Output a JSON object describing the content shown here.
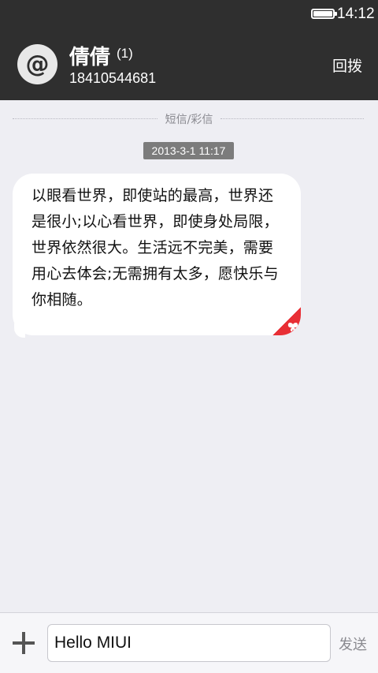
{
  "status_bar": {
    "time": "14:12"
  },
  "header": {
    "avatar_glyph": "@",
    "contact_name": "倩倩",
    "unread_count": "(1)",
    "contact_number": "18410544681",
    "call_back_label": "回拨"
  },
  "conversation": {
    "divider_label": "短信/彩信",
    "timestamp": "2013-3-1 11:17",
    "message": {
      "text": "以眼看世界，即使站的最高，世界还是很小;以心看世界，即使身处局限，世界依然很大。生活远不完美，需要用心去体会;无需拥有太多，愿快乐与你相随。",
      "badge_color": "#e82f35"
    }
  },
  "input_bar": {
    "add_icon": "plus-icon",
    "input_value": "Hello MIUI",
    "send_label": "发送"
  }
}
